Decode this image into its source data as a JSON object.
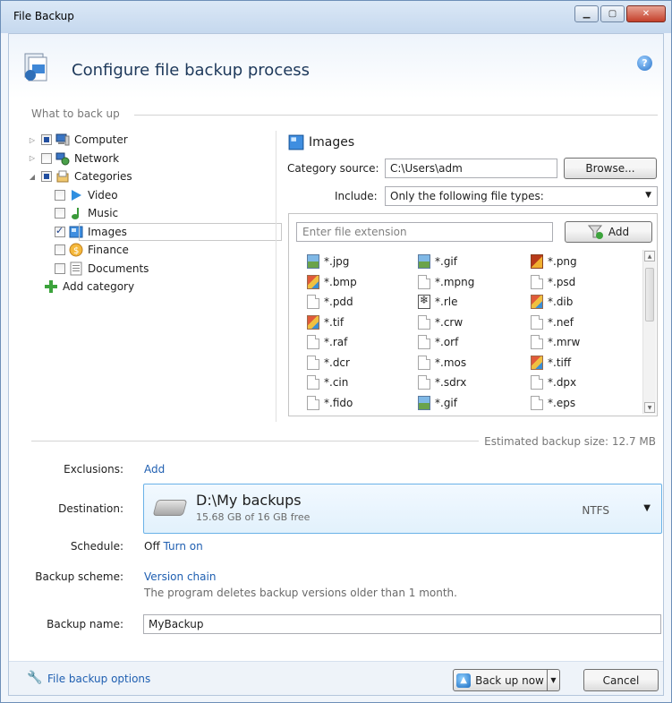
{
  "window": {
    "title": "File Backup"
  },
  "header": {
    "title": "Configure file backup process"
  },
  "what_to_back_up": {
    "section_label": "What to back up",
    "tree": [
      {
        "label": "Computer",
        "icon": "computer-icon",
        "level": 0,
        "check": "partial"
      },
      {
        "label": "Network",
        "icon": "network-icon",
        "level": 0,
        "check": "none"
      },
      {
        "label": "Categories",
        "icon": "categories-icon",
        "level": 0,
        "check": "partial"
      },
      {
        "label": "Video",
        "icon": "video-icon",
        "level": 1,
        "check": "none"
      },
      {
        "label": "Music",
        "icon": "music-icon",
        "level": 1,
        "check": "none"
      },
      {
        "label": "Images",
        "icon": "images-icon",
        "level": 1,
        "check": "checked",
        "selected": true
      },
      {
        "label": "Finance",
        "icon": "finance-icon",
        "level": 1,
        "check": "none"
      },
      {
        "label": "Documents",
        "icon": "documents-icon",
        "level": 1,
        "check": "none"
      },
      {
        "label": "Add category",
        "icon": "add-icon",
        "level": 1
      }
    ]
  },
  "category_panel": {
    "title": "Images",
    "source_label": "Category source:",
    "source_value": "C:\\Users\\adm",
    "browse_label": "Browse...",
    "include_label": "Include:",
    "include_value": "Only the following file types:",
    "extension_placeholder": "Enter file extension",
    "add_label": "Add",
    "file_types": [
      {
        "ext": "*.jpg",
        "icon": "img"
      },
      {
        "ext": "*.gif",
        "icon": "img"
      },
      {
        "ext": "*.png",
        "icon": "png"
      },
      {
        "ext": "*.bmp",
        "icon": "paint"
      },
      {
        "ext": "*.mpng",
        "icon": "doc"
      },
      {
        "ext": "*.psd",
        "icon": "doc"
      },
      {
        "ext": "*.pdd",
        "icon": "doc"
      },
      {
        "ext": "*.rle",
        "icon": "rle"
      },
      {
        "ext": "*.dib",
        "icon": "paint"
      },
      {
        "ext": "*.tif",
        "icon": "paint"
      },
      {
        "ext": "*.crw",
        "icon": "doc"
      },
      {
        "ext": "*.nef",
        "icon": "doc"
      },
      {
        "ext": "*.raf",
        "icon": "doc"
      },
      {
        "ext": "*.orf",
        "icon": "doc"
      },
      {
        "ext": "*.mrw",
        "icon": "doc"
      },
      {
        "ext": "*.dcr",
        "icon": "doc"
      },
      {
        "ext": "*.mos",
        "icon": "doc"
      },
      {
        "ext": "*.tiff",
        "icon": "paint"
      },
      {
        "ext": "*.cin",
        "icon": "doc"
      },
      {
        "ext": "*.sdrx",
        "icon": "doc"
      },
      {
        "ext": "*.dpx",
        "icon": "doc"
      },
      {
        "ext": "*.fido",
        "icon": "doc"
      },
      {
        "ext": "*.gif",
        "icon": "img"
      },
      {
        "ext": "*.eps",
        "icon": "doc"
      }
    ]
  },
  "estimate": "Estimated backup size: 12.7 MB",
  "settings": {
    "exclusions_label": "Exclusions:",
    "exclusions_link": "Add",
    "destination_label": "Destination:",
    "destination_path": "D:\\My backups",
    "destination_free": "15.68 GB of 16 GB free",
    "destination_fs": "NTFS",
    "schedule_label": "Schedule:",
    "schedule_value": "Off",
    "schedule_link": "Turn on",
    "scheme_label": "Backup scheme:",
    "scheme_link": "Version chain",
    "scheme_desc": "The program deletes backup versions older than 1 month.",
    "name_label": "Backup name:",
    "name_value": "MyBackup"
  },
  "footer": {
    "options_link": "File backup options",
    "backup_now": "Back up now",
    "cancel": "Cancel"
  },
  "colors": {
    "link": "#1f5fb1",
    "accent": "#6ab2e8"
  }
}
